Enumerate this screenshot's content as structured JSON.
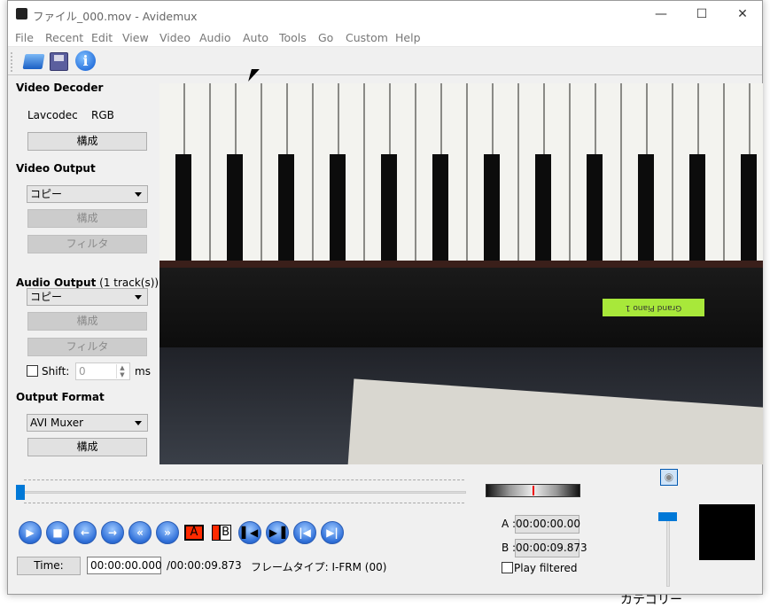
{
  "window": {
    "title": "ファイル_000.mov - Avidemux",
    "controls": [
      "minimize",
      "maximize",
      "close"
    ]
  },
  "menu": [
    "File",
    "Recent",
    "Edit",
    "View",
    "Video",
    "Audio",
    "Auto",
    "Tools",
    "Go",
    "Custom",
    "Help"
  ],
  "toolbar": {
    "icons": [
      "open-folder-icon",
      "save-floppy-icon",
      "info-icon"
    ]
  },
  "video_decoder": {
    "heading": "Video Decoder",
    "codec": "Lavcodec",
    "colorspace": "RGB",
    "configure": "構成"
  },
  "video_output": {
    "heading": "Video Output",
    "selected": "コピー",
    "configure": "構成",
    "filters": "フィルタ"
  },
  "audio_output": {
    "heading": "Audio Output",
    "tracks": "(1 track(s))",
    "selected": "コピー",
    "configure": "構成",
    "filters": "フィルタ",
    "shift_label": "Shift:",
    "shift_value": "0",
    "shift_unit": "ms",
    "shift_checked": false
  },
  "output_format": {
    "heading": "Output Format",
    "selected": "AVI Muxer",
    "configure": "構成"
  },
  "video_frame": {
    "lcd_text": "Grand Piano 1"
  },
  "timeline": {
    "position_fraction": 0.0
  },
  "transport": {
    "buttons": [
      "play",
      "stop",
      "previous-frame",
      "next-frame",
      "rewind",
      "fast-forward",
      "set-marker-a",
      "set-marker-b",
      "go-marker-a",
      "go-marker-b",
      "previous-keyframe",
      "next-keyframe"
    ],
    "marker_a_label": "A",
    "marker_b_label": "B"
  },
  "time": {
    "button": "Time:",
    "current": "00:00:00.000",
    "total": "/00:00:09.873",
    "frame_type": "フレームタイプ: I-FRM (00)"
  },
  "selection": {
    "a_label": "A :",
    "a_value": "00:00:00.00",
    "b_label": "B :",
    "b_value": "00:00:09.873",
    "play_filtered": "Play filtered",
    "play_filtered_checked": false
  },
  "volume": {
    "level": 1.0
  },
  "background": {
    "partial_text": "カテゴリー"
  },
  "colors": {
    "accent": "#0078d7",
    "marker_red": "#ff2a00"
  }
}
